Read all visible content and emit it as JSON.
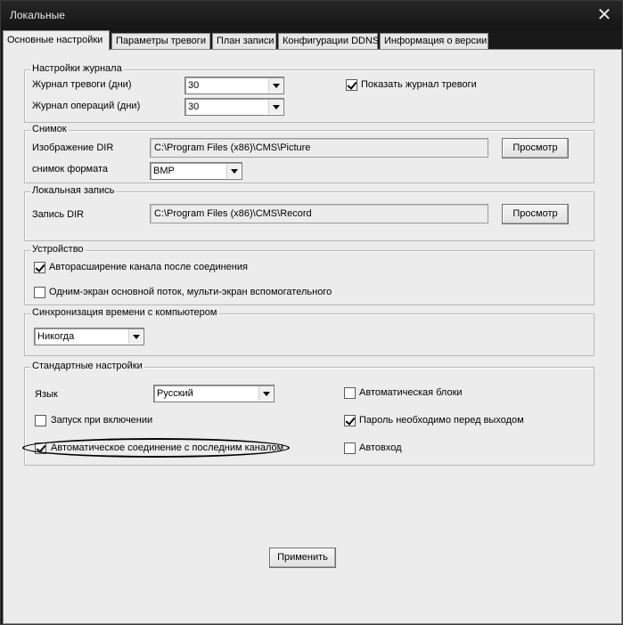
{
  "window": {
    "title": "Локальные",
    "close_glyph": "✕"
  },
  "tabs": [
    {
      "label": "Основные настройки",
      "active": true
    },
    {
      "label": "Параметры тревоги"
    },
    {
      "label": "План записи"
    },
    {
      "label": "Конфигурации DDNS"
    },
    {
      "label": "Информация о версии"
    }
  ],
  "log": {
    "legend": "Настройки журнала",
    "alarm_log_label": "Журнал тревоги (дни)",
    "alarm_log_value": "30",
    "operation_log_label": "Журнал операций (дни)",
    "operation_log_value": "30",
    "show_alarm_log_label": "Показать журнал тревоги",
    "show_alarm_log_checked": true
  },
  "snapshot": {
    "legend": "Снимок",
    "dir_label": "Изображение DIR",
    "dir_value": "C:\\Program Files (x86)\\CMS\\Picture",
    "browse_label": "Просмотр",
    "format_label": "снимок формата",
    "format_value": "BMP"
  },
  "local_record": {
    "legend": "Локальная запись",
    "dir_label": "Запись DIR",
    "dir_value": "C:\\Program Files (x86)\\CMS\\Record",
    "browse_label": "Просмотр"
  },
  "device": {
    "legend": "Устройство",
    "auto_expand_label": "Авторасширение канала после соединения",
    "auto_expand_checked": true,
    "single_screen_label": "Одним-экран основной поток, мульти-экран вспомогательного",
    "single_screen_checked": false
  },
  "time_sync": {
    "legend": "Синхронизация времени с компьютером",
    "value": "Никогда"
  },
  "standard": {
    "legend": "Стандартные настройки",
    "language_label": "Язык",
    "language_value": "Русский",
    "auto_lock_label": "Автоматическая блоки",
    "auto_lock_checked": false,
    "startup_label": "Запуск при включении",
    "startup_checked": false,
    "password_exit_label": "Пароль необходимо перед выходом",
    "password_exit_checked": true,
    "auto_connect_label": "Автоматическое соединение с последним каналом",
    "auto_connect_checked": true,
    "auto_login_label": "Автовход",
    "auto_login_checked": false
  },
  "apply_label": "Применить"
}
